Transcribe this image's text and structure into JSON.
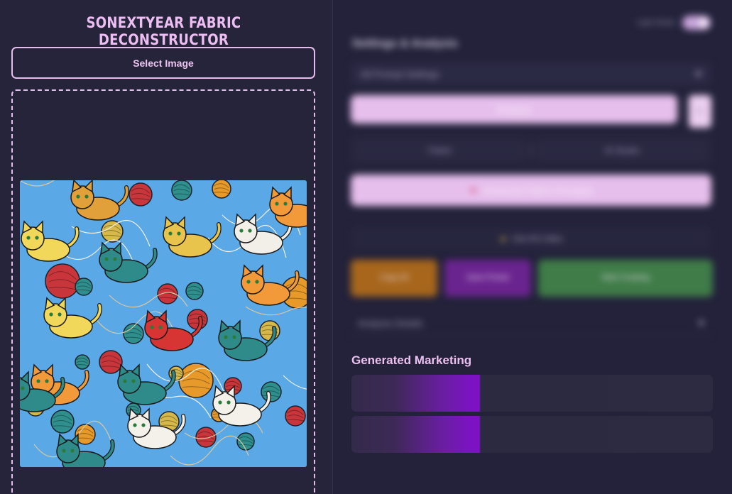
{
  "app": {
    "title": "SONEXTYEAR FABRIC DECONSTRUCTOR"
  },
  "left": {
    "select_label": "Select Image"
  },
  "right": {
    "toggle_label": "Light Mode",
    "settings_title": "Settings & Analysis",
    "preset_label": "All Prompt Settings",
    "analyze_label": "Analyze",
    "analyze_side_label": "↻",
    "pills": [
      "Fabric",
      "AI Studio"
    ],
    "generate_label": "Generate Fabric Prompts",
    "ai_label": "Use AI's Idea",
    "actions": {
      "orange": "Copy All",
      "purple": "Save Preset",
      "green": "Start Creating"
    },
    "analysis_label": "Analysis Details",
    "marketing_title": "Generated Marketing"
  },
  "colors": {
    "background": "#23223a",
    "accent": "#e6bfec",
    "orange": "#a7661c",
    "purple": "#6a248f",
    "green": "#3f7c48"
  },
  "icons": {
    "chevron": "chevron-down-icon",
    "generate": "sparkle-icon",
    "ai": "lightbulb-icon"
  }
}
